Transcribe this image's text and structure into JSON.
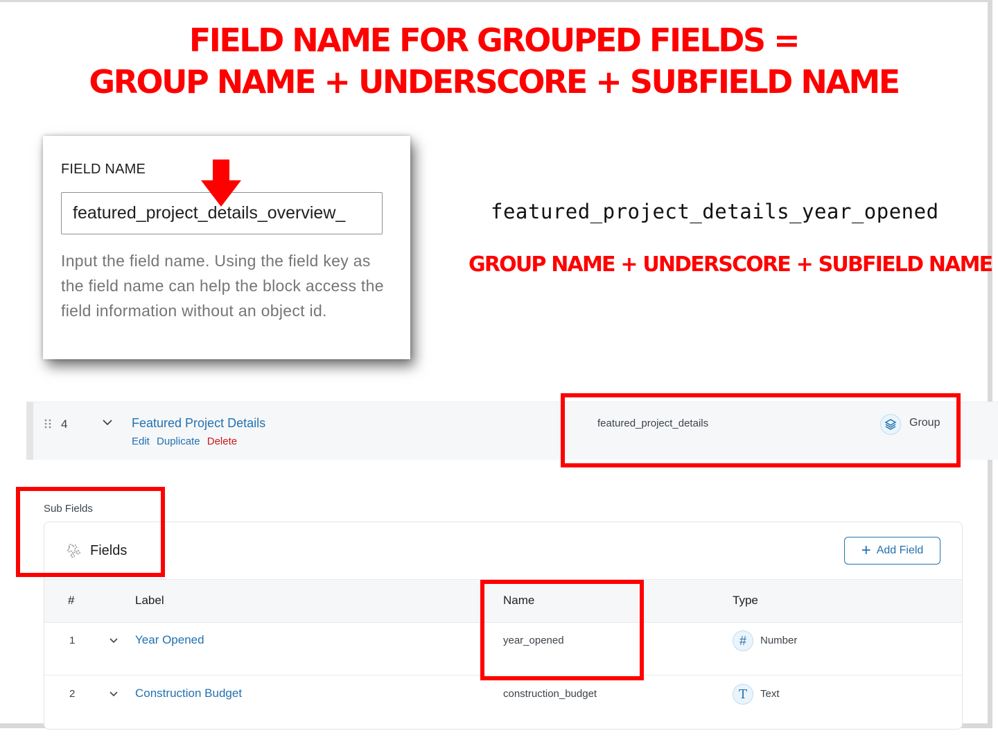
{
  "headline": {
    "line1": "FIELD NAME FOR GROUPED FIELDS =",
    "line2": "GROUP NAME + UNDERSCORE + SUBFIELD NAME"
  },
  "field_card": {
    "label": "FIELD NAME",
    "input_value": "featured_project_details_overview_",
    "help_text": "Input the field name. Using the field key as the field name can help the block access the field information without an object id."
  },
  "example": {
    "full_name": "featured_project_details_year_opened",
    "formula": "GROUP NAME + UNDERSCORE + SUBFIELD NAME"
  },
  "group_row": {
    "number": "4",
    "title": "Featured Project Details",
    "actions": {
      "edit": "Edit",
      "duplicate": "Duplicate",
      "delete": "Delete"
    },
    "name": "featured_project_details",
    "type": "Group",
    "type_icon": "layers-icon"
  },
  "sub_fields": {
    "section_label": "Sub Fields",
    "panel_title": "Fields",
    "add_button": "Add Field",
    "columns": [
      "#",
      "Label",
      "Name",
      "Type"
    ],
    "rows": [
      {
        "num": "1",
        "label": "Year Opened",
        "name": "year_opened",
        "type": "Number",
        "type_icon": "#"
      },
      {
        "num": "2",
        "label": "Construction Budget",
        "name": "construction_budget",
        "type": "Text",
        "type_icon": "T"
      }
    ]
  },
  "colors": {
    "annotation_red": "#ff0000",
    "link_blue": "#2271b1",
    "delete_red": "#cc1818"
  }
}
